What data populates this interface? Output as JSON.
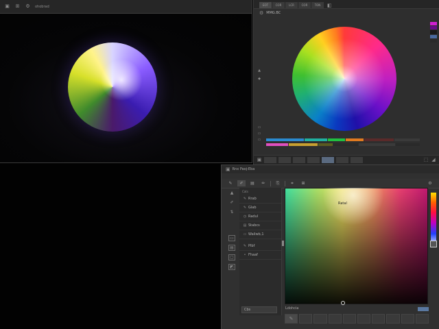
{
  "preview_window": {
    "title": "ohobrad",
    "title_icons": [
      "window-icon",
      "grid-icon",
      "settings-icon"
    ]
  },
  "wheel_window": {
    "tabs": [
      "EOT",
      "COR",
      "LCR",
      "COR",
      "TON"
    ],
    "subbar_label": "MMG.BC",
    "swatches": [
      "#d020d0",
      "#6a0a8a",
      "#1a1a1a",
      "#4a6aa0",
      "#2a2a2a"
    ],
    "bars": [
      [
        "#2a8ad0",
        "#20b0a0",
        "#20c040",
        "#e07a20",
        "#5a2a2a",
        "#3a3a3a"
      ],
      [
        "#e050c0",
        "#c8a030",
        "#5a5a20",
        "#2a2a2a",
        "#3a3a3a",
        "#2a2a2a"
      ]
    ]
  },
  "picker_window": {
    "title": "Rnx Paoj-Eba",
    "tools_top": [
      "brush-icon",
      "pen-icon",
      "comment-icon",
      "pencil-icon",
      "stamp-icon",
      "crop-icon"
    ],
    "list_header": "Cats",
    "list_items": [
      {
        "icon": "edit-icon",
        "label": "Rrab"
      },
      {
        "icon": "edit-icon",
        "label": "Glab"
      },
      {
        "icon": "clock-icon",
        "label": "Radul"
      },
      {
        "icon": "image-icon",
        "label": "Stabcs"
      },
      {
        "icon": "folder-icon",
        "label": "Wailwb,1"
      }
    ],
    "list_items_lower": [
      {
        "icon": "edit-icon",
        "label": "Plbf"
      },
      {
        "icon": "dot-icon",
        "label": "Fhaaf"
      }
    ],
    "bottom_field": "Cbs",
    "field_label": "Ratal",
    "field_caption": "Ldohcia"
  }
}
